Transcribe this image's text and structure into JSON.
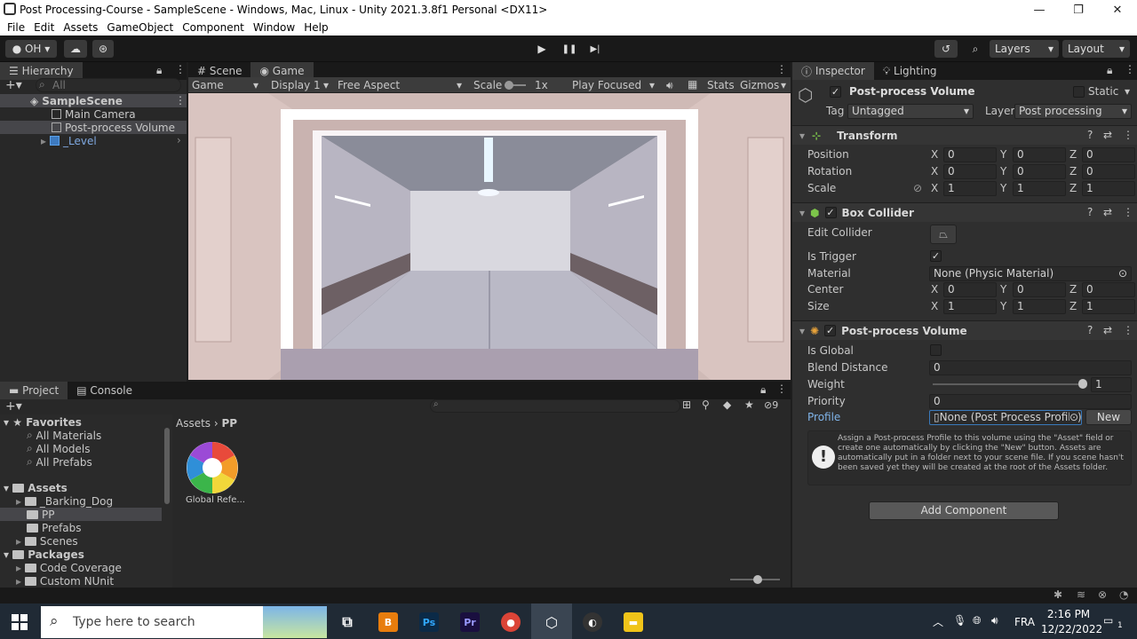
{
  "window": {
    "title": "Post Processing-Course - SampleScene - Windows, Mac, Linux - Unity 2021.3.8f1 Personal <DX11>",
    "minimize": "—",
    "restore": "❐",
    "close": "✕"
  },
  "menu": [
    "File",
    "Edit",
    "Assets",
    "GameObject",
    "Component",
    "Window",
    "Help"
  ],
  "toolbar": {
    "account": "OH",
    "play": "▶",
    "pause": "❚❚",
    "step": "▶|",
    "layers": "Layers",
    "layout": "Layout"
  },
  "hierarchy": {
    "tab": "Hierarchy",
    "search_placeholder": "All",
    "scene": "SampleScene",
    "items": [
      "Main Camera",
      "Post-process Volume",
      "_Level"
    ]
  },
  "game": {
    "tabs": [
      "Scene",
      "Game"
    ],
    "mode": "Game",
    "display": "Display 1",
    "aspect": "Free Aspect",
    "scale_label": "Scale",
    "scale_value": "1x",
    "play_focused": "Play Focused",
    "stats": "Stats",
    "gizmos": "Gizmos"
  },
  "project": {
    "tabs": [
      "Project",
      "Console"
    ],
    "hidden_count": "9",
    "breadcrumb": [
      "Assets",
      "PP"
    ],
    "favorites": "Favorites",
    "fav_items": [
      "All Materials",
      "All Models",
      "All Prefabs"
    ],
    "assets": "Assets",
    "asset_items": [
      "_Barking_Dog",
      "PP",
      "Prefabs",
      "Scenes"
    ],
    "packages": "Packages",
    "package_items": [
      "Code Coverage",
      "Custom NUnit"
    ],
    "file": "Global Refe..."
  },
  "inspector": {
    "tabs": [
      "Inspector",
      "Lighting"
    ],
    "object_name": "Post-process Volume",
    "static": "Static",
    "tag_label": "Tag",
    "tag": "Untagged",
    "layer_label": "Layer",
    "layer": "Post processing",
    "transform": {
      "title": "Transform",
      "rows": [
        {
          "label": "Position",
          "x": "0",
          "y": "0",
          "z": "0"
        },
        {
          "label": "Rotation",
          "x": "0",
          "y": "0",
          "z": "0"
        },
        {
          "label": "Scale",
          "x": "1",
          "y": "1",
          "z": "1"
        }
      ]
    },
    "box_collider": {
      "title": "Box Collider",
      "edit": "Edit Collider",
      "is_trigger": "Is Trigger",
      "material_label": "Material",
      "material": "None (Physic Material)",
      "rows": [
        {
          "label": "Center",
          "x": "0",
          "y": "0",
          "z": "0"
        },
        {
          "label": "Size",
          "x": "1",
          "y": "1",
          "z": "1"
        }
      ]
    },
    "volume": {
      "title": "Post-process Volume",
      "is_global": "Is Global",
      "blend_label": "Blend Distance",
      "blend": "0",
      "weight_label": "Weight",
      "weight": "1",
      "weight_fraction": 1.0,
      "priority_label": "Priority",
      "priority": "0",
      "profile_label": "Profile",
      "profile": "None (Post Process Profile)",
      "new": "New",
      "help": "Assign a Post-process Profile to this volume using the \"Asset\" field or create one automatically by clicking the \"New\" button. Assets are automatically put in a folder next to your scene file. If you scene hasn't been saved yet they will be created at the root of the Assets folder."
    },
    "add_component": "Add Component",
    "axis": [
      "X",
      "Y",
      "Z"
    ]
  },
  "taskbar": {
    "search_placeholder": "Type here to search",
    "lang": "FRA",
    "time": "2:16 PM",
    "date": "12/22/2022",
    "notif": "1"
  }
}
